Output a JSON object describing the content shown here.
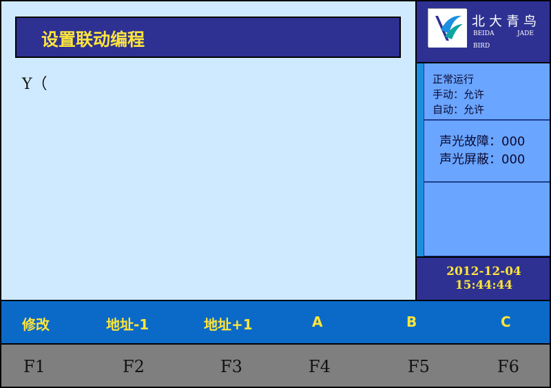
{
  "main": {
    "title": "设置联动编程",
    "input_text": "Y（"
  },
  "logo": {
    "cn": "北大青鸟",
    "en_left": "BEIDA",
    "en_right": "JADE",
    "en_bottom": "BIRD"
  },
  "status": {
    "run": "正常运行",
    "manual": "手动：允许",
    "auto": "自动：允许",
    "sound_fault": "声光故障：000",
    "sound_mask": "声光屏蔽：000"
  },
  "datetime": {
    "date": "2012-12-04",
    "time": "15:44:44"
  },
  "function_labels": [
    "修改",
    "地址-1",
    "地址+1",
    "A",
    "B",
    "C"
  ],
  "function_keys": [
    "F1",
    "F2",
    "F3",
    "F4",
    "F5",
    "F6"
  ],
  "colors": {
    "title_bg": "#2e3192",
    "title_text": "#ffe53b",
    "main_bg": "#cfeaff",
    "fkey_bg": "#0b6ac8",
    "fnum_bg": "#7f7f7f"
  }
}
